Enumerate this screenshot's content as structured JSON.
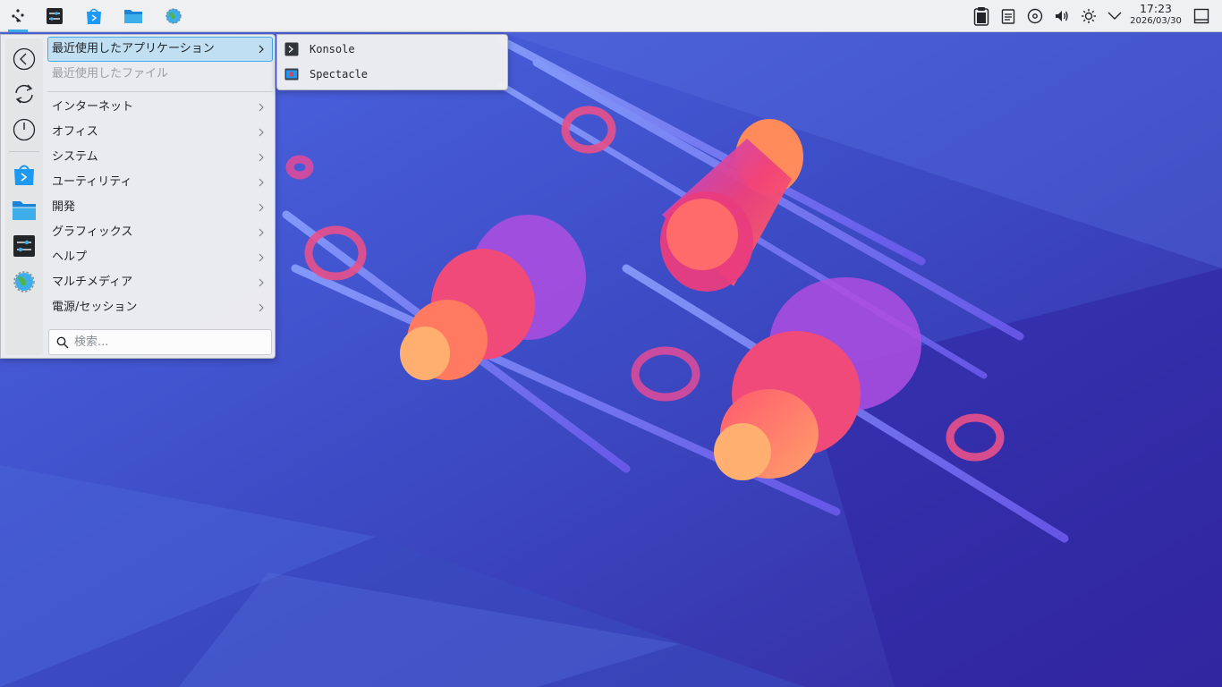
{
  "panel": {
    "launcher_icon": "kde-launcher-icon",
    "tasks": [
      {
        "name": "system-settings-icon"
      },
      {
        "name": "discover-icon"
      },
      {
        "name": "dolphin-icon"
      },
      {
        "name": "web-browser-icon"
      }
    ],
    "tray": [
      {
        "name": "clipboard-icon"
      },
      {
        "name": "notes-icon"
      },
      {
        "name": "media-disc-icon"
      },
      {
        "name": "volume-icon"
      },
      {
        "name": "brightness-icon"
      },
      {
        "name": "expand-tray-chevron-icon"
      }
    ],
    "clock": {
      "time": "17:23",
      "date": "2026/03/30"
    },
    "show_desktop_icon": "show-desktop-icon"
  },
  "menu": {
    "sidebar": [
      {
        "name": "back-icon"
      },
      {
        "name": "refresh-icon"
      },
      {
        "name": "power-icon"
      },
      {
        "name": "discover-icon"
      },
      {
        "name": "dolphin-icon"
      },
      {
        "name": "system-settings-icon"
      },
      {
        "name": "web-browser-icon"
      }
    ],
    "items": [
      {
        "label": "最近使用したアプリケーション",
        "state": "active"
      },
      {
        "label": "最近使用したファイル",
        "state": "disabled"
      },
      {
        "label": "インターネット"
      },
      {
        "label": "オフィス"
      },
      {
        "label": "システム"
      },
      {
        "label": "ユーティリティ"
      },
      {
        "label": "開発"
      },
      {
        "label": "グラフィックス"
      },
      {
        "label": "ヘルプ"
      },
      {
        "label": "マルチメディア"
      },
      {
        "label": "電源/セッション"
      }
    ],
    "search": {
      "placeholder": "検索..."
    }
  },
  "submenu": {
    "items": [
      {
        "label": "Konsole",
        "icon": "konsole-icon"
      },
      {
        "label": "Spectacle",
        "icon": "spectacle-icon"
      }
    ]
  },
  "colors": {
    "accent": "#3daee9",
    "wallpaper_base": "#3a3fb0"
  }
}
